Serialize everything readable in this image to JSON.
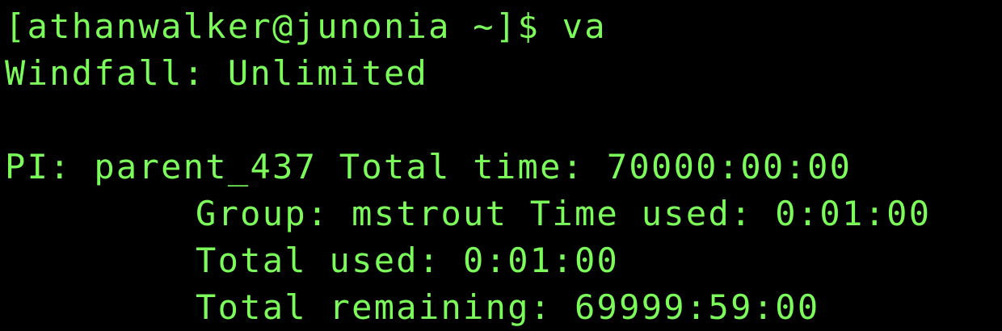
{
  "terminal": {
    "prompt": "[athanwalker@junonia ~]$",
    "command": "va",
    "lines": {
      "windfall": "Windfall: Unlimited",
      "pi_line": "PI: parent_437 Total time: 70000:00:00",
      "group_line": "Group: mstrout Time used: 0:01:00",
      "total_used": "Total used: 0:01:00",
      "total_remaining": "Total remaining: 69999:59:00"
    },
    "colors": {
      "background": "#000000",
      "text": "#7CFC5A"
    }
  }
}
